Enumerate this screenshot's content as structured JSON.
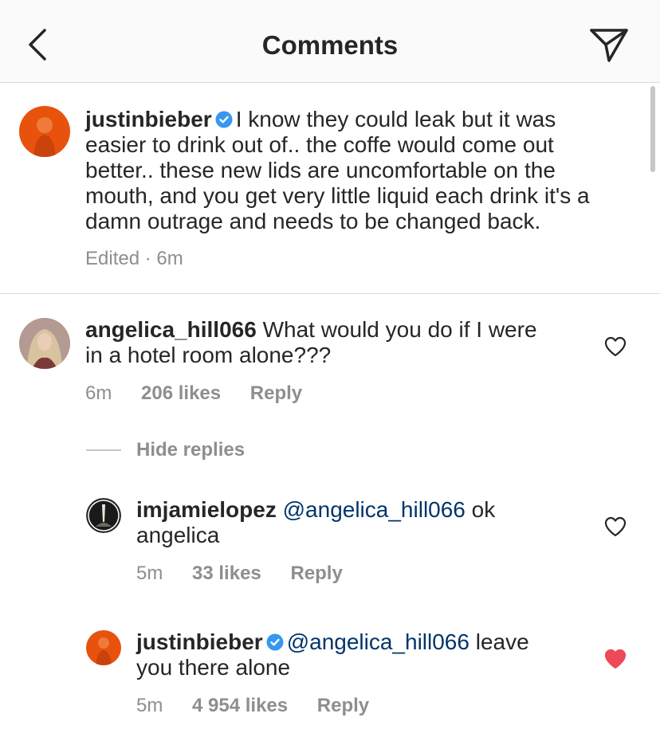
{
  "header": {
    "title": "Comments",
    "back_icon": "chevron-left-icon",
    "send_icon": "direct-send-icon"
  },
  "caption": {
    "username": "justinbieber",
    "verified": true,
    "text_line1": "I know they could leak but it was",
    "text_line2": "easier to drink out of.. the coffe would come out",
    "text_line3": "better.. these new lids are uncomfortable on the",
    "text_line4": "mouth, and you get very little liquid each drink it's a",
    "text_line5": "damn outrage and needs to be changed back.",
    "meta": "Edited · 6m"
  },
  "comments": [
    {
      "username": "angelica_hill066",
      "text_line1": "What would you do if I were",
      "text_line2": "in a hotel room alone???",
      "time": "6m",
      "likes": "206 likes",
      "reply": "Reply",
      "liked": false
    }
  ],
  "hide_replies": "Hide replies",
  "replies": [
    {
      "username": "imjamielopez",
      "mention": "@angelica_hill066",
      "text_line1_tail": "ok",
      "text_line2": "angelica",
      "time": "5m",
      "likes": "33 likes",
      "reply": "Reply",
      "liked": false
    },
    {
      "username": "justinbieber",
      "verified": true,
      "mention": "@angelica_hill066",
      "text_line1_tail": "leave",
      "text_line2": "you there alone",
      "time": "5m",
      "likes": "4 954 likes",
      "reply": "Reply",
      "liked": true
    }
  ],
  "colors": {
    "mention": "#003569",
    "muted": "#8e8e8e",
    "verified": "#3897f0",
    "heart_active": "#ed4956"
  }
}
